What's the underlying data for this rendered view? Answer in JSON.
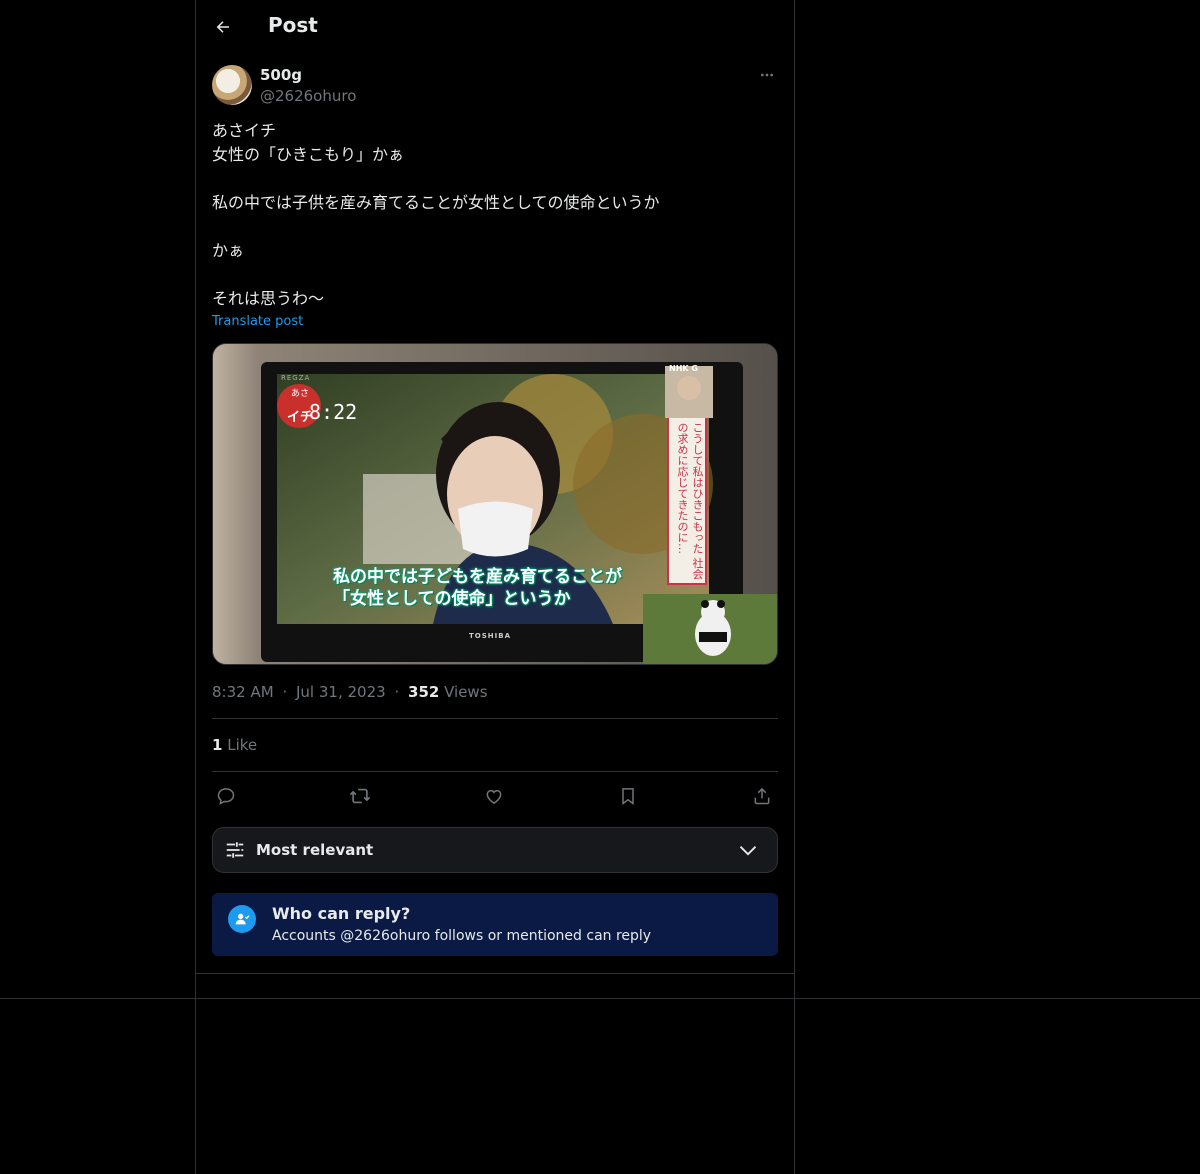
{
  "header": {
    "title": "Post"
  },
  "author": {
    "name": "500g",
    "handle": "@2626ohuro"
  },
  "post": {
    "text": "あさイチ\n女性の「ひきこもり」かぁ\n\n私の中では子供を産み育てることが女性としての使命というか\n\nかぁ\n\nそれは思うわ〜",
    "translate_label": "Translate post"
  },
  "media": {
    "tv_brand_top": "REGZA",
    "tv_brand_bottom": "TOSHIBA",
    "clock": "8:22",
    "channel": "NHK G",
    "show_logo_top": "あさ",
    "show_logo_bottom": "イチ",
    "subtitle_line1": "私の中では子どもを産み育てることが",
    "subtitle_line2": "「女性としての使命」というか",
    "side_caption": "こうして私はひきこもった 社会の求めに応じてきたのに…"
  },
  "meta": {
    "time": "8:32 AM",
    "date": "Jul 31, 2023",
    "views_count": "352",
    "views_label": "Views",
    "separator": "·"
  },
  "stats": {
    "likes_count": "1",
    "likes_label": "Like"
  },
  "sort": {
    "label": "Most relevant"
  },
  "reply_info": {
    "title": "Who can reply?",
    "subtitle": "Accounts @2626ohuro follows or mentioned can reply"
  },
  "colors": {
    "accent": "#1d9bf0",
    "background": "#000000",
    "border": "#2f3336",
    "muted": "#71767b",
    "notice_bg": "#0a1a44"
  }
}
